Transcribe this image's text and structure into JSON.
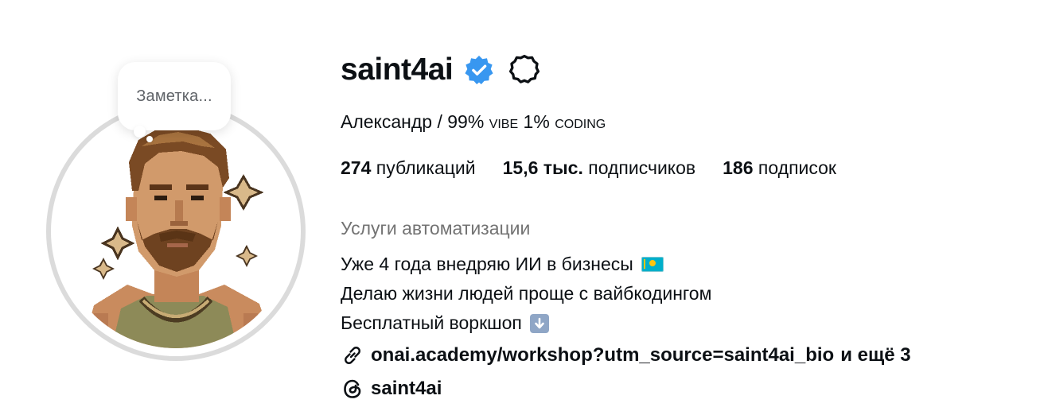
{
  "profile": {
    "username": "saint4ai",
    "full_name_prefix": "Александр / 99% ",
    "full_name_sc1": "vibe",
    "full_name_mid": " 1% ",
    "full_name_sc2": "coding",
    "note_text": "Заметка...",
    "stats": {
      "posts_count": "274",
      "posts_label": "публикаций",
      "followers_count": "15,6 тыс.",
      "followers_label": "подписчиков",
      "following_count": "186",
      "following_label": "подписок"
    },
    "category": "Услуги автоматизации",
    "bio_lines": [
      "Уже 4 года внедряю ИИ в бизнесы",
      "Делаю жизни людей проще с вайбкодингом",
      "Бесплатный воркшоп"
    ],
    "bio_emojis": [
      "flag-kazakhstan",
      "down-arrow-emoji"
    ],
    "link_text": "onai.academy/workshop?utm_source=saint4ai_bio",
    "link_more": "и ещё 3",
    "threads_handle": "saint4ai"
  },
  "colors": {
    "verified_badge": "#3897f0",
    "secondary_text": "#737373",
    "primary_text": "#0c1014",
    "avatar_ring": "#dbdbdb"
  },
  "icons": [
    "verified-badge-icon",
    "options-gear-icon",
    "link-icon",
    "threads-icon"
  ]
}
